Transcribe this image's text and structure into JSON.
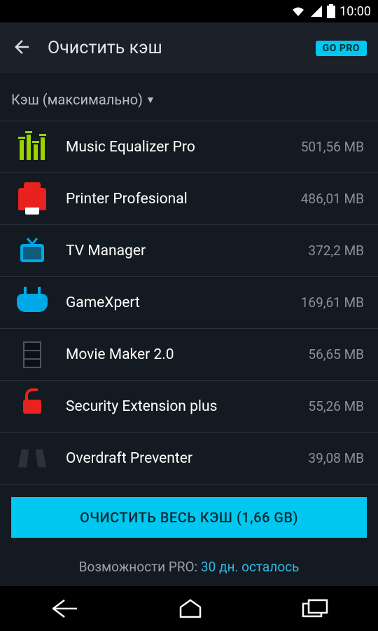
{
  "status": {
    "time": "10:00"
  },
  "header": {
    "title": "Очистить кэш",
    "go_pro": "GO PRO"
  },
  "sort": {
    "label": "Кэш (максимально)"
  },
  "apps": [
    {
      "name": "Music Equalizer Pro",
      "size": "501,56 MB",
      "icon": "equalizer"
    },
    {
      "name": "Printer Profesional",
      "size": "486,01 MB",
      "icon": "printer"
    },
    {
      "name": "TV Manager",
      "size": "372,2 MB",
      "icon": "tv"
    },
    {
      "name": "GameXpert",
      "size": "169,61 MB",
      "icon": "gamepad"
    },
    {
      "name": "Movie Maker 2.0",
      "size": "56,65 MB",
      "icon": "film"
    },
    {
      "name": "Security Extension plus",
      "size": "55,26 MB",
      "icon": "lock"
    },
    {
      "name": "Overdraft Preventer",
      "size": "39,08 MB",
      "icon": "shape"
    }
  ],
  "clean_button": "ОЧИСТИТЬ ВЕСЬ КЭШ (1,66 GB)",
  "footer": {
    "prefix": "Возможности PRO: ",
    "accent": "30 дн. осталось"
  }
}
